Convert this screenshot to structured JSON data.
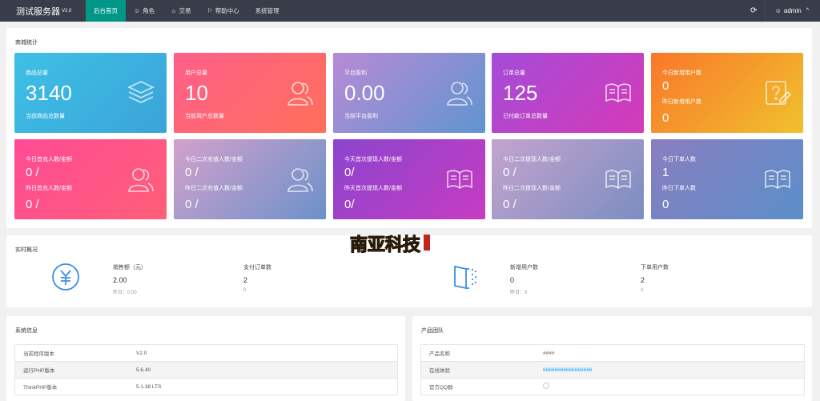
{
  "header": {
    "app_title": "测试服务器",
    "version": "V2.0",
    "nav": [
      {
        "label": "后台首页",
        "icon": ""
      },
      {
        "label": "角色",
        "icon": "user-icon"
      },
      {
        "label": "交易",
        "icon": "globe-icon"
      },
      {
        "label": "帮助中心",
        "icon": "flag-icon"
      },
      {
        "label": "系统管理",
        "icon": ""
      }
    ],
    "user": "admin"
  },
  "mall_stats": {
    "title": "商城统计",
    "cards": [
      {
        "label": "商品总量",
        "value": "3140",
        "sub": "当前商品总数量",
        "icon": "layers-icon"
      },
      {
        "label": "用户总量",
        "value": "10",
        "sub": "当前用户总数量",
        "icon": "users-icon"
      },
      {
        "label": "平台盈利",
        "value": "0.00",
        "sub": "当前平台盈利",
        "icon": "users-icon"
      },
      {
        "label": "订单总量",
        "value": "125",
        "sub": "已付款订单总数量",
        "icon": "book-icon"
      },
      {
        "label": "今日新增用户数",
        "value": "0",
        "label2": "昨日新增用户数",
        "value2": "0",
        "icon": "help-edit-icon"
      },
      {
        "label": "今日首充人数/金额",
        "value": "0 /",
        "label2": "昨日首充人数/金额",
        "value2": "0 /",
        "icon": "users-icon"
      },
      {
        "label": "今日二次充值人数/金额",
        "value": "0 /",
        "label2": "昨日二次充值人数/金额",
        "value2": "0 /",
        "icon": "users-icon"
      },
      {
        "label": "今天首次提现人数/金额",
        "value": "0/",
        "label2": "昨天首次提现人数/金额",
        "value2": "0/",
        "icon": "book-icon"
      },
      {
        "label": "今日二次提现人数/金额",
        "value": "0 /",
        "label2": "昨日二次提现人数/金额",
        "value2": "0 /",
        "icon": "book-icon"
      },
      {
        "label": "今日下单人数",
        "value": "1",
        "label2": "昨日下单人数",
        "value2": "0",
        "icon": "book-icon"
      }
    ]
  },
  "realtime": {
    "title": "实时概况",
    "items": [
      {
        "label": "销售额（元）",
        "value": "2.00",
        "sub": "昨日：0.00"
      },
      {
        "label": "支付订单数",
        "value": "2",
        "sub": "0"
      },
      {
        "label": "新增用户数",
        "value": "0",
        "sub": "昨日：0"
      },
      {
        "label": "下单用户数",
        "value": "2",
        "sub": "0"
      }
    ]
  },
  "system_info": {
    "title": "系统信息",
    "rows": [
      {
        "key": "当前程序版本",
        "value": "V2.0"
      },
      {
        "key": "运行PHP版本",
        "value": "5.6.40"
      },
      {
        "key": "ThinkPHP版本",
        "value": "5.1.38 LTS"
      }
    ]
  },
  "product_team": {
    "title": "产品团队",
    "rows": [
      {
        "key": "产品名称",
        "value": "####"
      },
      {
        "key": "在线体验",
        "value": "66666666666666666"
      },
      {
        "key": "官方QQ群",
        "value": ""
      }
    ]
  },
  "watermark": {
    "text": "南亚科技"
  },
  "colors": {
    "topbar": "#393d49",
    "active_nav": "#009688",
    "link": "#1e9fff",
    "icon_blue": "#3a8ee6"
  }
}
